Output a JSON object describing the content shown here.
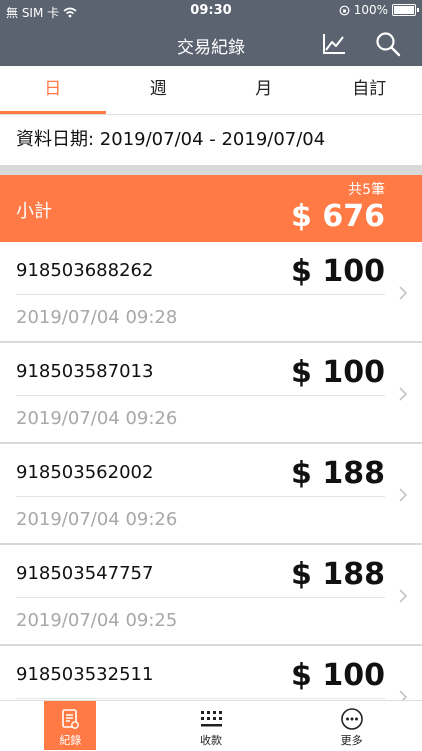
{
  "status_bar": {
    "carrier": "無 SIM 卡",
    "time": "09:30",
    "battery": "100%"
  },
  "header": {
    "title": "交易紀錄",
    "chart_icon": "line-chart-icon",
    "search_icon": "search-icon"
  },
  "tabs": [
    {
      "label": "日",
      "active": true
    },
    {
      "label": "週",
      "active": false
    },
    {
      "label": "月",
      "active": false
    },
    {
      "label": "自訂",
      "active": false
    }
  ],
  "date_range": "資料日期: 2019/07/04 - 2019/07/04",
  "subtotal": {
    "label": "小計",
    "count": "共5筆",
    "total": "$ 676"
  },
  "transactions": [
    {
      "id": "918503688262",
      "amount": "$ 100",
      "time": "2019/07/04 09:28"
    },
    {
      "id": "918503587013",
      "amount": "$ 100",
      "time": "2019/07/04 09:26"
    },
    {
      "id": "918503562002",
      "amount": "$ 188",
      "time": "2019/07/04 09:26"
    },
    {
      "id": "918503547757",
      "amount": "$ 188",
      "time": "2019/07/04 09:25"
    },
    {
      "id": "918503532511",
      "amount": "$ 100",
      "time": ""
    }
  ],
  "bottom_nav": [
    {
      "label": "紀錄",
      "icon": "receipt-icon",
      "active": true
    },
    {
      "label": "收款",
      "icon": "keypad-icon",
      "active": false
    },
    {
      "label": "更多",
      "icon": "more-icon",
      "active": false
    }
  ],
  "colors": {
    "accent": "#ff7a45",
    "header": "#5b6370"
  }
}
